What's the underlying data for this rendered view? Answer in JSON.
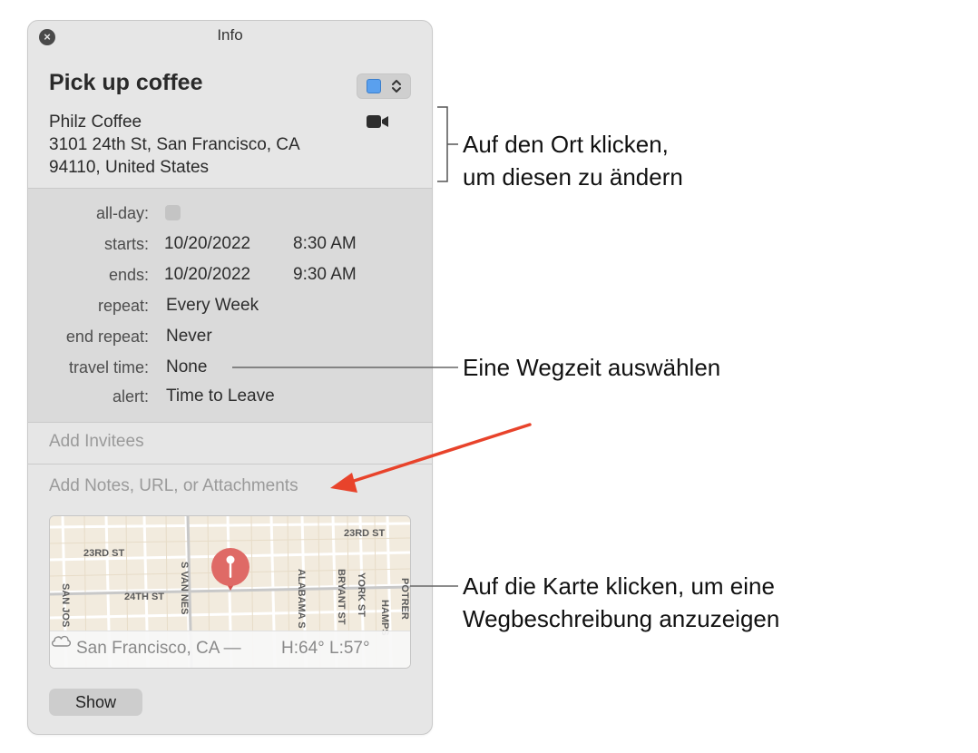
{
  "window": {
    "title": "Info",
    "close_icon": "close-icon"
  },
  "event": {
    "title": "Pick up coffee",
    "calendar_color": "#5aa0ee",
    "location_name": "Philz Coffee",
    "location_line1": "3101 24th St, San Francisco, CA",
    "location_line2": "94110, United States"
  },
  "details": {
    "allday_label": "all-day:",
    "starts_label": "starts:",
    "starts_date": "10/20/2022",
    "starts_time": "8:30 AM",
    "ends_label": "ends:",
    "ends_date": "10/20/2022",
    "ends_time": "9:30 AM",
    "repeat_label": "repeat:",
    "repeat_value": "Every Week",
    "end_repeat_label": "end repeat:",
    "end_repeat_value": "Never",
    "travel_label": "travel time:",
    "travel_value": "None",
    "alert_label": "alert:",
    "alert_value": "Time to Leave"
  },
  "invitees_placeholder": "Add Invitees",
  "notes_placeholder": "Add Notes, URL, or Attachments",
  "map": {
    "streets": {
      "s23_left": "23RD ST",
      "s23_right": "23RD ST",
      "s24": "24TH ST",
      "san_jose": "SAN JOS",
      "s_van_ness": "S VAN NES",
      "alabama": "ALABAMA S",
      "bryant": "BRYANT ST",
      "york": "YORK ST",
      "hampshire": "HAMPS",
      "potrero": "POTRER"
    },
    "weather_city": "San Francisco, CA —",
    "weather_temps": "H:64° L:57°"
  },
  "show_button": "Show",
  "callouts": {
    "location_1": "Auf den Ort klicken,",
    "location_2": "um diesen zu ändern",
    "travel": "Eine Wegzeit auswählen",
    "map_1": "Auf die Karte klicken, um eine",
    "map_2": "Wegbeschreibung anzuzeigen"
  },
  "arrow_color": "#e8432b"
}
